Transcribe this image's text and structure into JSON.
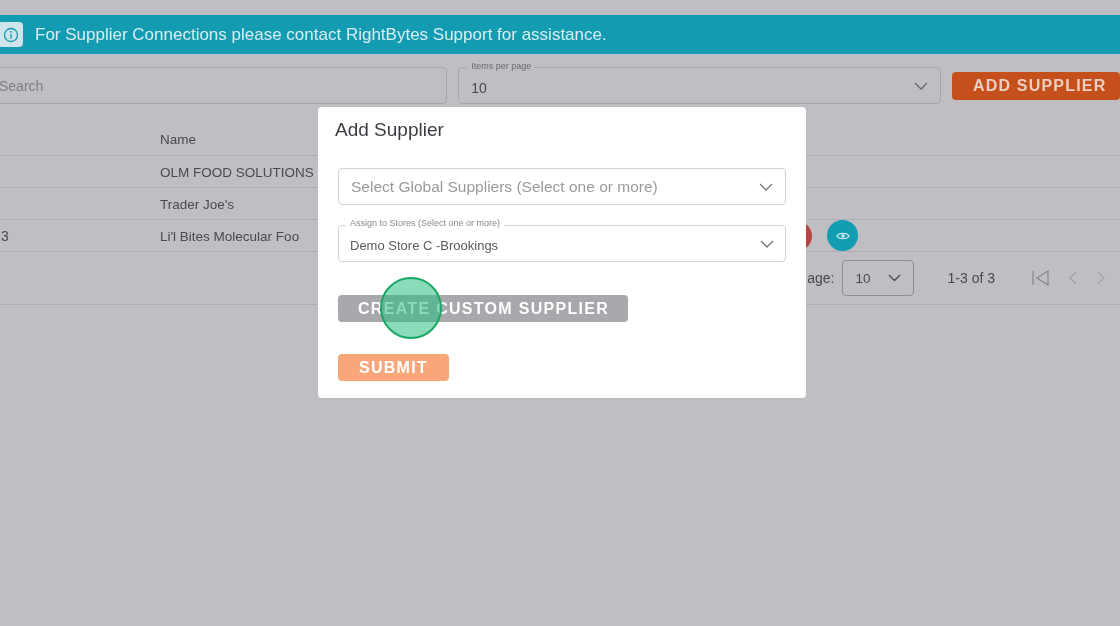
{
  "banner": {
    "text": "For Supplier Connections please contact RightBytes Support for assistance."
  },
  "toolbar": {
    "search": {
      "placeholder": "Search"
    },
    "items_per_page": {
      "label": "Items per page",
      "value": "10"
    },
    "add_button": "ADD SUPPLIER"
  },
  "table": {
    "columns": [
      "Name"
    ],
    "rows": [
      {
        "name": "OLM FOOD SOLUTIONS",
        "actions": false
      },
      {
        "name": "Trader Joe's",
        "actions": false
      },
      {
        "column_1": "3",
        "name": "Li'l Bites Molecular Foo",
        "actions": true
      }
    ]
  },
  "pagination": {
    "rows_label": "age:",
    "rows_value": "10",
    "range": "1-3 of 3"
  },
  "dialog": {
    "title": "Add Supplier",
    "global_suppliers": {
      "placeholder": "Select Global Suppliers (Select one or more)"
    },
    "stores": {
      "label": "Assign to Stores (Select one or more)",
      "value": "Demo Store C -Brookings"
    },
    "buttons": [
      {
        "label": "CREATE CUSTOM SUPPLIER",
        "kind": "secondary"
      },
      {
        "label": "SUBMIT",
        "kind": "primary"
      }
    ]
  }
}
